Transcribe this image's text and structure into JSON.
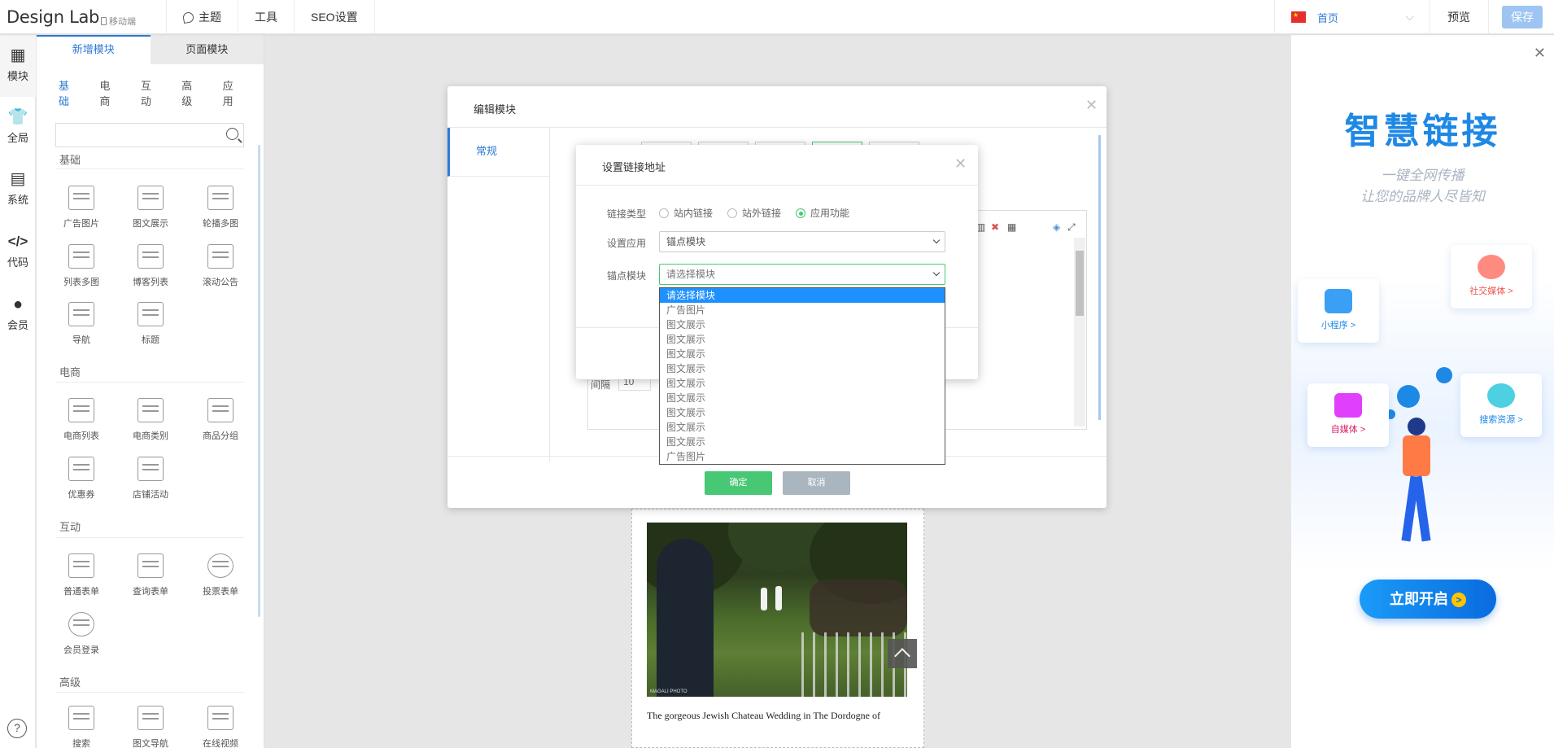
{
  "app": {
    "logo": "Design Lab",
    "mobile_tag": "移动端",
    "nav": [
      "主题",
      "工具",
      "SEO设置"
    ],
    "page_select": "首页",
    "preview": "预览",
    "save": "保存"
  },
  "rail": {
    "items": [
      {
        "label": "模块",
        "icon": "grid-icon"
      },
      {
        "label": "全局",
        "icon": "shirt-icon"
      },
      {
        "label": "系统",
        "icon": "document-icon"
      },
      {
        "label": "代码",
        "icon": "code-icon"
      },
      {
        "label": "会员",
        "icon": "user-icon"
      }
    ],
    "help": "?"
  },
  "modules_panel": {
    "tabs": [
      "新增模块",
      "页面模块"
    ],
    "categories": [
      "基础",
      "电商",
      "互动",
      "高级",
      "应用"
    ],
    "search_placeholder": "",
    "sections": [
      {
        "title": "基础",
        "items": [
          "广告图片",
          "图文展示",
          "轮播多图",
          "列表多图",
          "博客列表",
          "滚动公告",
          "导航",
          "标题"
        ]
      },
      {
        "title": "电商",
        "items": [
          "电商列表",
          "电商类别",
          "商品分组",
          "优惠券",
          "店铺活动"
        ]
      },
      {
        "title": "互动",
        "items": [
          "普通表单",
          "查询表单",
          "投票表单",
          "会员登录"
        ]
      },
      {
        "title": "高级",
        "items": [
          "搜索",
          "图文导航",
          "在线视频"
        ]
      }
    ]
  },
  "edit_dialog": {
    "title": "编辑模块",
    "side_tab": "常规",
    "spacing_label": "间隔",
    "spacing_value": "10",
    "confirm": "确定",
    "cancel": "取消"
  },
  "link_dialog": {
    "title": "设置链接地址",
    "link_type_label": "链接类型",
    "link_types": [
      "站内链接",
      "站外链接",
      "应用功能"
    ],
    "selected_type": "应用功能",
    "set_app_label": "设置应用",
    "set_app_value": "锚点模块",
    "anchor_label": "锚点模块",
    "anchor_value": "请选择模块",
    "options": [
      "请选择模块",
      "广告图片",
      "图文展示",
      "图文展示",
      "图文展示",
      "图文展示",
      "图文展示",
      "图文展示",
      "图文展示",
      "图文展示",
      "图文展示",
      "广告图片"
    ]
  },
  "canvas": {
    "caption": "The gorgeous Jewish Chateau Wedding in The Dordogne of"
  },
  "ad": {
    "title": "智慧链接",
    "subtitle_1": "一键全网传播",
    "subtitle_2": "让您的品牌人尽皆知",
    "cards": [
      "小程序 >",
      "社交媒体 >",
      "自媒体 >",
      "搜索资源 >"
    ],
    "button": "立即开启"
  },
  "colors": {
    "accent": "#2e7bd6",
    "confirm": "#48c774",
    "cancel": "#aab6bf",
    "highlight": "#1e90ff"
  }
}
